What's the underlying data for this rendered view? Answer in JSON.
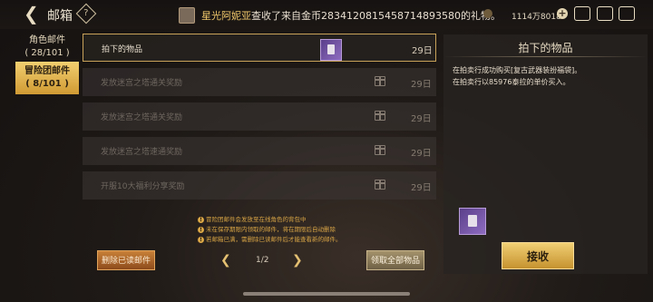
{
  "header": {
    "back_icon": "back-arrow-icon",
    "title": "邮箱",
    "help_icon": "?",
    "notice_name": "星光阿妮亚",
    "notice_text": "查收了来自金币2834120815458714893580的礼物。",
    "currency_value": "1114万8018",
    "plus_label": "+"
  },
  "tabs": [
    {
      "label": "角色邮件",
      "count": "( 28/101 )"
    },
    {
      "label": "冒险团邮件",
      "count": "( 8/101 )"
    }
  ],
  "mails": [
    {
      "title": "拍下的物品",
      "days": "29日",
      "icon": "item-box-icon"
    },
    {
      "title": "发放迷宫之塔通关奖励",
      "days": "29日",
      "icon": "gift-icon"
    },
    {
      "title": "发放迷宫之塔通关奖励",
      "days": "29日",
      "icon": "gift-icon"
    },
    {
      "title": "发放迷宫之塔速通奖励",
      "days": "29日",
      "icon": "gift-icon"
    },
    {
      "title": "开服10大福利分享奖励",
      "days": "29日",
      "icon": "gift-icon"
    }
  ],
  "notes": [
    "冒险团邮件会发放至在线角色的背包中",
    "未在保存期限内领取的邮件，将在期限后自动删除",
    "若邮箱已满，需删除已读邮件后才能查看新的邮件。"
  ],
  "footer": {
    "delete_read_label": "删除已读邮件",
    "page_label": "1/2",
    "collect_all_label": "领取全部物品"
  },
  "detail": {
    "title": "拍下的物品",
    "line1": "在拍卖行成功购买[复古武器装扮福袋]。",
    "line2": "在拍卖行以85976泰拉的单价买入。",
    "receive_label": "接收"
  }
}
